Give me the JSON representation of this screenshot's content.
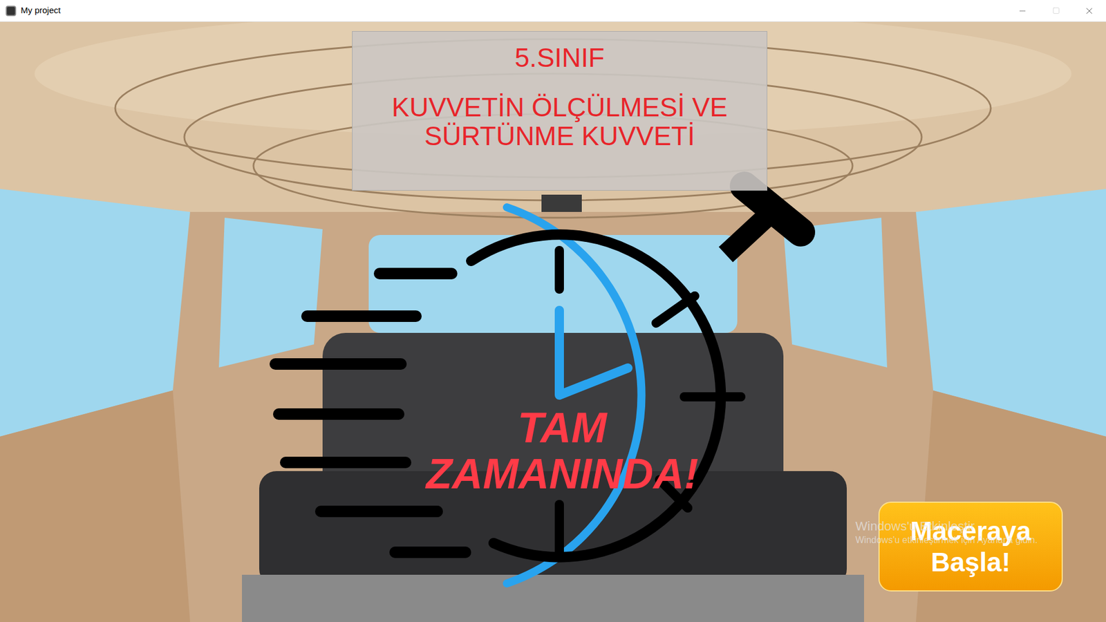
{
  "window": {
    "title": "My project"
  },
  "header": {
    "grade": "5.SINIF",
    "topic_lines": [
      "KUVVETİN ÖLÇÜLMESİ VE",
      "SÜRTÜNME KUVVETİ"
    ]
  },
  "logo": {
    "lines": [
      "TAM",
      "ZAMANINDA!"
    ]
  },
  "start_button": {
    "label": "Maceraya Başla!"
  },
  "watermark": {
    "title": "Windows'u Etkinleştir",
    "subtitle": "Windows'u etkinleştirmek için Ayarlar'a gidin."
  }
}
